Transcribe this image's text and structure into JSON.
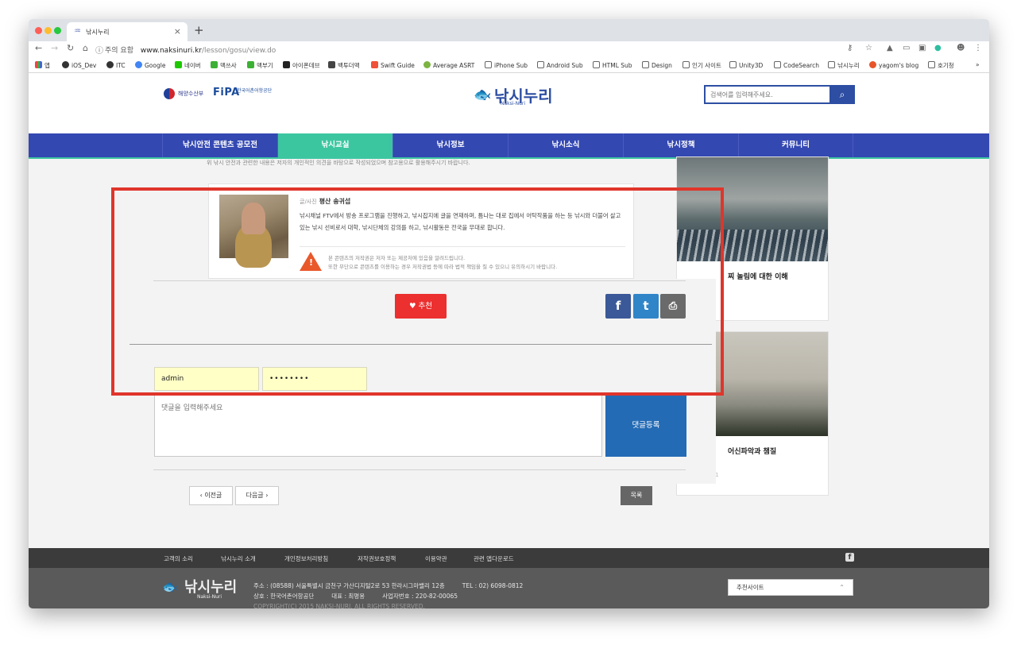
{
  "browser": {
    "tab_title": "낚시누리",
    "url_warning": "주의 요함",
    "url_host": "www.naksinuri.kr",
    "url_path": "/lesson/gosu/view.do",
    "bookmarks": [
      "앱",
      "iOS_Dev",
      "ITC",
      "Google",
      "네이버",
      "맥쓰사",
      "맥부기",
      "아이폰데브",
      "백투더맥",
      "Swift Guide",
      "Average ASRT",
      "iPhone Sub",
      "Android Sub",
      "HTML Sub",
      "Design",
      "인기 사이트",
      "Unity3D",
      "CodeSearch",
      "낚시누리",
      "yagom's blog",
      "호기청"
    ],
    "bookmarks_more": "»"
  },
  "header": {
    "gov_label": "해양수산부",
    "fipa_logo": "FiPA",
    "fipa_label": "한국어촌어항공단",
    "logo_text": "낚시누리",
    "logo_sub": "Naksi-Nuri",
    "search_placeholder": "검색어를 입력해주세요."
  },
  "nav": {
    "items": [
      "낚시안전 콘텐츠 공모전",
      "낚시교실",
      "낚시정보",
      "낚시소식",
      "낚시정책",
      "커뮤니티"
    ],
    "active_index": 1
  },
  "article": {
    "top_line": "위 낚시 안전과 관련한 내용은 저자의 개인적인 의견을 바탕으로 작성되었으며 참고용으로 활용해주시기 바랍니다.",
    "writer_label": "글/사진",
    "writer_name": "평산 송귀섭",
    "bio": "낚시채널 FTV에서 방송 프로그램을 진행하고, 낚시잡지에 글을 연재하며, 틈나는 대로 집에서 어탁작품을 하는 등 낚시와 더불어 살고 있는 낚시 선비로서 대학, 낚시단체의 강의를 하고, 낚시활동은 전국을 무대로 합니다.",
    "notice_1": "본 콘텐츠의 저작권은 저자 또는 제공처에 있음을 알려드립니다.",
    "notice_2": "또한 무단으로 콘텐츠를 이용하는 경우 저작권법 등에 따라 법적 책임을 질 수 있으니 유의하시기 바랍니다."
  },
  "actions": {
    "recommend_label": "추천",
    "share_facebook": "f",
    "share_twitter": "t",
    "share_print": "⎙"
  },
  "comment_form": {
    "user_id": "admin",
    "password_mask": "••••••••",
    "placeholder": "댓글을 입력해주세요",
    "submit_label": "댓글등록"
  },
  "pager": {
    "prev_label": "‹ 이전글",
    "next_label": "다음글 ›",
    "list_label": "목록"
  },
  "sidebar": {
    "cards": [
      {
        "title": "찌 놀림에 대한 이해",
        "date": ""
      },
      {
        "title": "어신파악과 챔질",
        "date": "2017-10-11"
      }
    ]
  },
  "footer": {
    "links": [
      "고객의 소리",
      "낚시누리 소개",
      "개인정보처리방침",
      "저작권보호정책",
      "이용약관",
      "관련 앱다운로드"
    ],
    "address": "주소 : (08588) 서울특별시 금천구 가산디지털2로 53 한라시그마밸리 12층",
    "tel": "TEL : 02) 6098-0812",
    "company": "상호 : 한국어촌어항공단",
    "ceo": "대표 : 최명용",
    "biz_no": "사업자번호 : 220-82-00065",
    "copyright": "COPYRIGHT(C) 2015 NAKSI-NURI. ALL RIGHTS RESERVED.",
    "recommend_site": "추천사이트",
    "logo_text": "낚시누리",
    "logo_sub": "Naksi-Nuri"
  },
  "colors": {
    "nav_bg": "#3448b2",
    "nav_active": "#3cc6a0",
    "recommend_red": "#ec2f2f",
    "submit_blue": "#246bb5",
    "highlight_frame": "#e0352b"
  }
}
